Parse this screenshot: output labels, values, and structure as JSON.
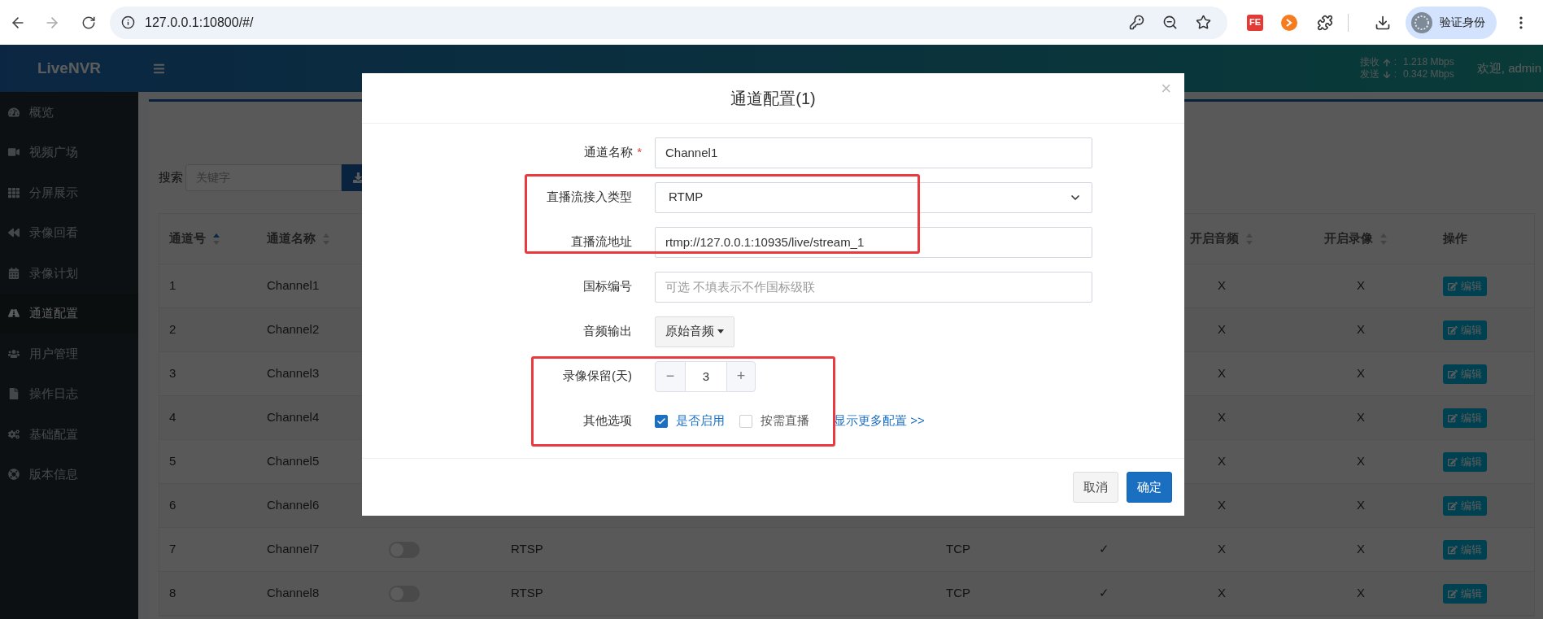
{
  "browser": {
    "url": "127.0.0.1:10800/#/",
    "extension_badge": "FE",
    "profile_label": "验证身份"
  },
  "header": {
    "logo": "LiveNVR",
    "stats": [
      {
        "label": "接收",
        "separator": ":",
        "value": "1.218 Mbps"
      },
      {
        "label": "发送",
        "separator": ":",
        "value": "0.342 Mbps"
      }
    ],
    "welcome": "欢迎, admin"
  },
  "sidebar": {
    "items": [
      {
        "label": "概览",
        "selected": false
      },
      {
        "label": "视频广场",
        "selected": false
      },
      {
        "label": "分屏展示",
        "selected": false
      },
      {
        "label": "录像回看",
        "selected": false
      },
      {
        "label": "录像计划",
        "selected": false
      },
      {
        "label": "通道配置",
        "selected": true
      },
      {
        "label": "用户管理",
        "selected": false
      },
      {
        "label": "操作日志",
        "selected": false
      },
      {
        "label": "基础配置",
        "selected": false
      },
      {
        "label": "版本信息",
        "selected": false
      }
    ]
  },
  "search": {
    "label": "搜索",
    "placeholder": "关键字"
  },
  "table": {
    "columns": [
      {
        "label": "通道号",
        "sortable": true,
        "sorted": true
      },
      {
        "label": "通道名称",
        "sortable": true,
        "sorted": false
      },
      {
        "label": "开启音频",
        "sortable": true,
        "sorted": false
      },
      {
        "label": "开启录像",
        "sortable": true,
        "sorted": false
      },
      {
        "label": "操作",
        "sortable": false
      }
    ],
    "rows": [
      {
        "number": "1",
        "name": "Channel1",
        "audio": "X",
        "record": "X",
        "action": "编辑"
      },
      {
        "number": "2",
        "name": "Channel2",
        "audio": "X",
        "record": "X",
        "action": "编辑"
      },
      {
        "number": "3",
        "name": "Channel3",
        "audio": "X",
        "record": "X",
        "action": "编辑"
      },
      {
        "number": "4",
        "name": "Channel4",
        "audio": "X",
        "record": "X",
        "action": "编辑"
      },
      {
        "number": "5",
        "name": "Channel5",
        "audio": "X",
        "record": "X",
        "action": "编辑"
      },
      {
        "number": "6",
        "name": "Channel6",
        "audio": "X",
        "record": "X",
        "action": "编辑"
      },
      {
        "number": "7",
        "name": "Channel7",
        "column_3": {
          "on": false
        },
        "column_4": "RTSP",
        "column_5": "TCP",
        "column_6": "✓",
        "audio": "X",
        "record": "X",
        "action": "编辑"
      },
      {
        "number": "8",
        "name": "Channel8",
        "column_3": {
          "on": false
        },
        "column_4": "RTSP",
        "column_5": "TCP",
        "column_6": "✓",
        "audio": "X",
        "record": "X",
        "action": "编辑"
      }
    ]
  },
  "dialog": {
    "title": "通道配置(1)",
    "close": "×",
    "fields": [
      {
        "kind": "text",
        "label": "通道名称",
        "required_mark": "*",
        "highlighted": false,
        "value": "Channel1"
      },
      {
        "kind": "select",
        "label": "直播流接入类型",
        "highlighted": true,
        "value": "RTMP"
      },
      {
        "kind": "text",
        "label": "直播流地址",
        "highlighted": true,
        "value": "rtmp://127.0.0.1:10935/live/stream_1"
      },
      {
        "kind": "text",
        "label": "国标编号",
        "highlighted": false,
        "placeholder": "可选 不填表示不作国标级联"
      },
      {
        "kind": "dropdown",
        "label": "音频输出",
        "highlighted": false,
        "value": "原始音频"
      },
      {
        "kind": "stepper",
        "label": "录像保留(天)",
        "highlighted": true,
        "minus": "−",
        "value": "3",
        "plus": "+"
      },
      {
        "kind": "options",
        "label": "其他选项",
        "highlighted": true,
        "checkboxes": [
          {
            "label": "是否启用",
            "checked": true
          },
          {
            "label": "按需直播",
            "checked": false
          }
        ],
        "link": "显示更多配置 >>"
      }
    ],
    "buttons": [
      {
        "label": "取消",
        "kind": "default"
      },
      {
        "label": "确定",
        "kind": "primary"
      }
    ]
  }
}
